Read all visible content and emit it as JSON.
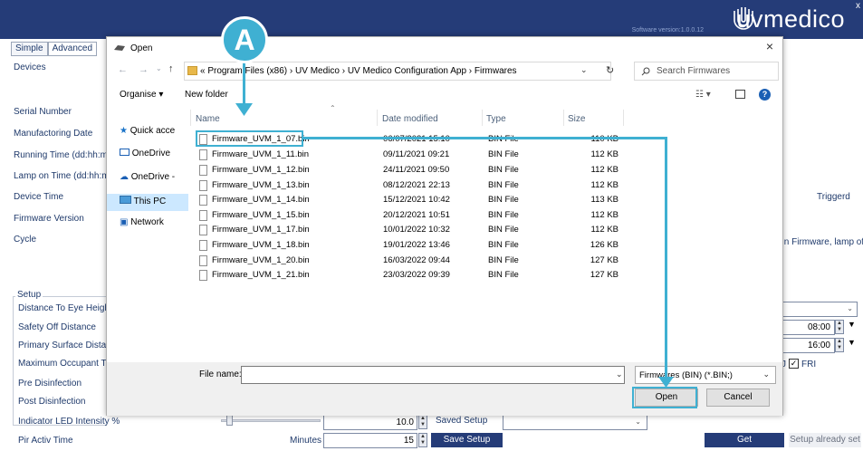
{
  "app": {
    "software_version": "Software version:1.0.0.12",
    "logo_text": "uvmedico",
    "close_glyph": "x",
    "tabs": [
      "Simple",
      "Advanced"
    ]
  },
  "left_labels": {
    "devices": "Devices",
    "serial_number": "Serial Number",
    "manufacturing_date": "Manufactoring Date",
    "running_time": "Running Time (dd:hh:mn",
    "lamp_on_time": "Lamp on Time (dd:hh:mr",
    "device_time": "Device Time",
    "firmware_version": "Firmware Version",
    "cycle": "Cycle"
  },
  "right_texts": {
    "triggered": "Triggerd",
    "firmware_lamp": "In Firmware, lamp off",
    "time1": "08:00",
    "time2": "16:00",
    "fri": "FRI",
    "j": "J"
  },
  "setup": {
    "title": "Setup",
    "items": [
      "Distance To Eye Height",
      "Safety Off Distance",
      "Primary Surface Distanc",
      "Maximum Occupant Tir",
      "Pre Disinfection",
      "Post Disinfection",
      "Indicator LED Intensity %",
      "Pir Activ Time"
    ],
    "minutes_label": "Minutes",
    "led_value": "10.0",
    "pir_value": "15",
    "saved_setup_label": "Saved Setup",
    "save_setup_button": "Save Setup",
    "get_button": "Get",
    "setup_already_set": "Setup already set"
  },
  "dialog": {
    "title": "Open",
    "breadcrumb": "«  Program Files (x86)  ›  UV Medico  ›  UV Medico Configuration App  ›  Firmwares",
    "search_placeholder": "Search Firmwares",
    "organise": "Organise ▾",
    "new_folder": "New folder",
    "nav_items": [
      "Quick acce",
      "OneDrive",
      "OneDrive -",
      "This PC",
      "Network"
    ],
    "columns": {
      "name": "Name",
      "date": "Date modified",
      "type": "Type",
      "size": "Size"
    },
    "files": [
      {
        "name": "Firmware_UVM_1_07.bin",
        "date": "06/07/2021 15:10",
        "type": "BIN File",
        "size": "110 KB"
      },
      {
        "name": "Firmware_UVM_1_11.bin",
        "date": "09/11/2021 09:21",
        "type": "BIN File",
        "size": "112 KB"
      },
      {
        "name": "Firmware_UVM_1_12.bin",
        "date": "24/11/2021 09:50",
        "type": "BIN File",
        "size": "112 KB"
      },
      {
        "name": "Firmware_UVM_1_13.bin",
        "date": "08/12/2021 22:13",
        "type": "BIN File",
        "size": "112 KB"
      },
      {
        "name": "Firmware_UVM_1_14.bin",
        "date": "15/12/2021 10:42",
        "type": "BIN File",
        "size": "113 KB"
      },
      {
        "name": "Firmware_UVM_1_15.bin",
        "date": "20/12/2021 10:51",
        "type": "BIN File",
        "size": "112 KB"
      },
      {
        "name": "Firmware_UVM_1_17.bin",
        "date": "10/01/2022 10:32",
        "type": "BIN File",
        "size": "112 KB"
      },
      {
        "name": "Firmware_UVM_1_18.bin",
        "date": "19/01/2022 13:46",
        "type": "BIN File",
        "size": "126 KB"
      },
      {
        "name": "Firmware_UVM_1_20.bin",
        "date": "16/03/2022 09:44",
        "type": "BIN File",
        "size": "127 KB"
      },
      {
        "name": "Firmware_UVM_1_21.bin",
        "date": "23/03/2022 09:39",
        "type": "BIN File",
        "size": "127 KB"
      }
    ],
    "file_name_label": "File name:",
    "file_name_value": "",
    "filter": "Firmwares (BIN) (*.BIN;)",
    "open_button": "Open",
    "cancel_button": "Cancel"
  },
  "annotation": {
    "marker_label": "A",
    "color": "#3fb0d2"
  }
}
